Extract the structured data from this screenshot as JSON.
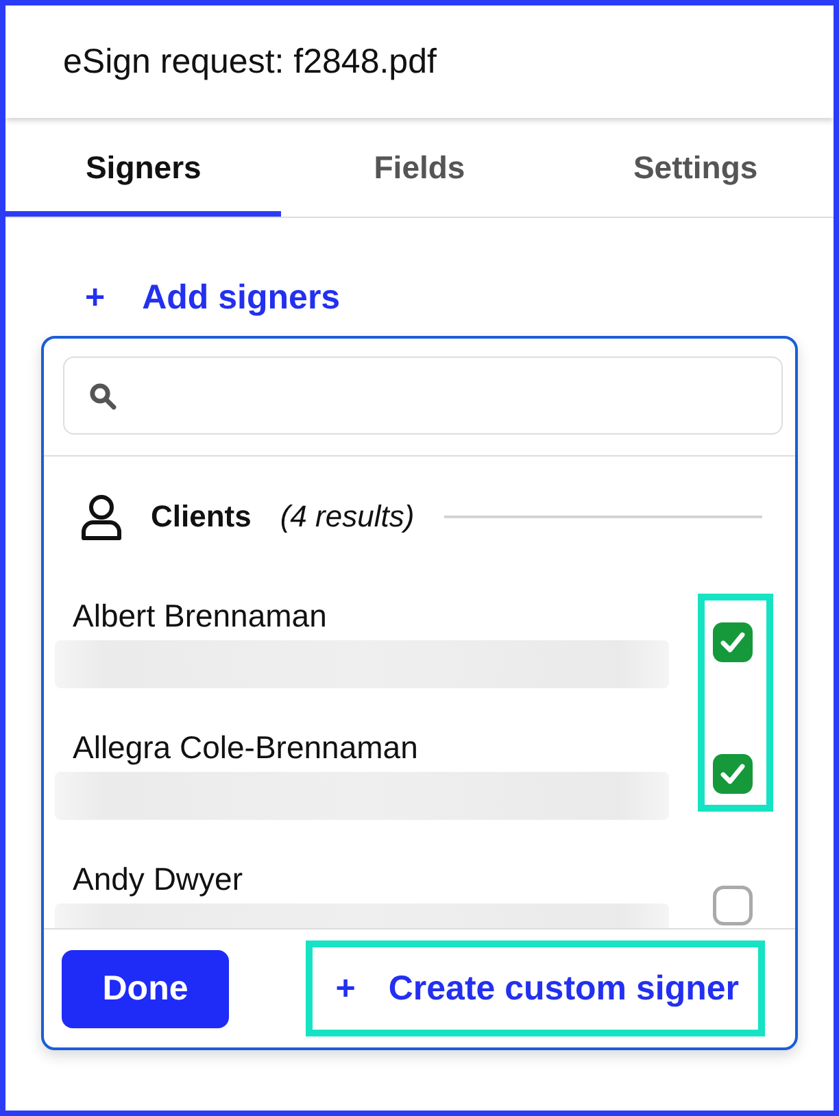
{
  "header": {
    "title": "eSign request: f2848.pdf"
  },
  "tabs": [
    {
      "label": "Signers",
      "selected": true
    },
    {
      "label": "Fields",
      "selected": false
    },
    {
      "label": "Settings",
      "selected": false
    }
  ],
  "add_signers": {
    "icon": "+",
    "label": "Add signers"
  },
  "picker": {
    "group": {
      "label": "Clients",
      "count": "(4 results)"
    },
    "signers": [
      {
        "name": "Albert Brennaman",
        "checked": true,
        "highlighted": true
      },
      {
        "name": "Allegra Cole-Brennaman",
        "checked": true,
        "highlighted": true
      },
      {
        "name": "Andy Dwyer",
        "checked": false,
        "highlighted": false
      }
    ],
    "done_button": "Done",
    "create_button": {
      "icon": "+",
      "label": "Create custom signer",
      "highlighted": true
    }
  }
}
